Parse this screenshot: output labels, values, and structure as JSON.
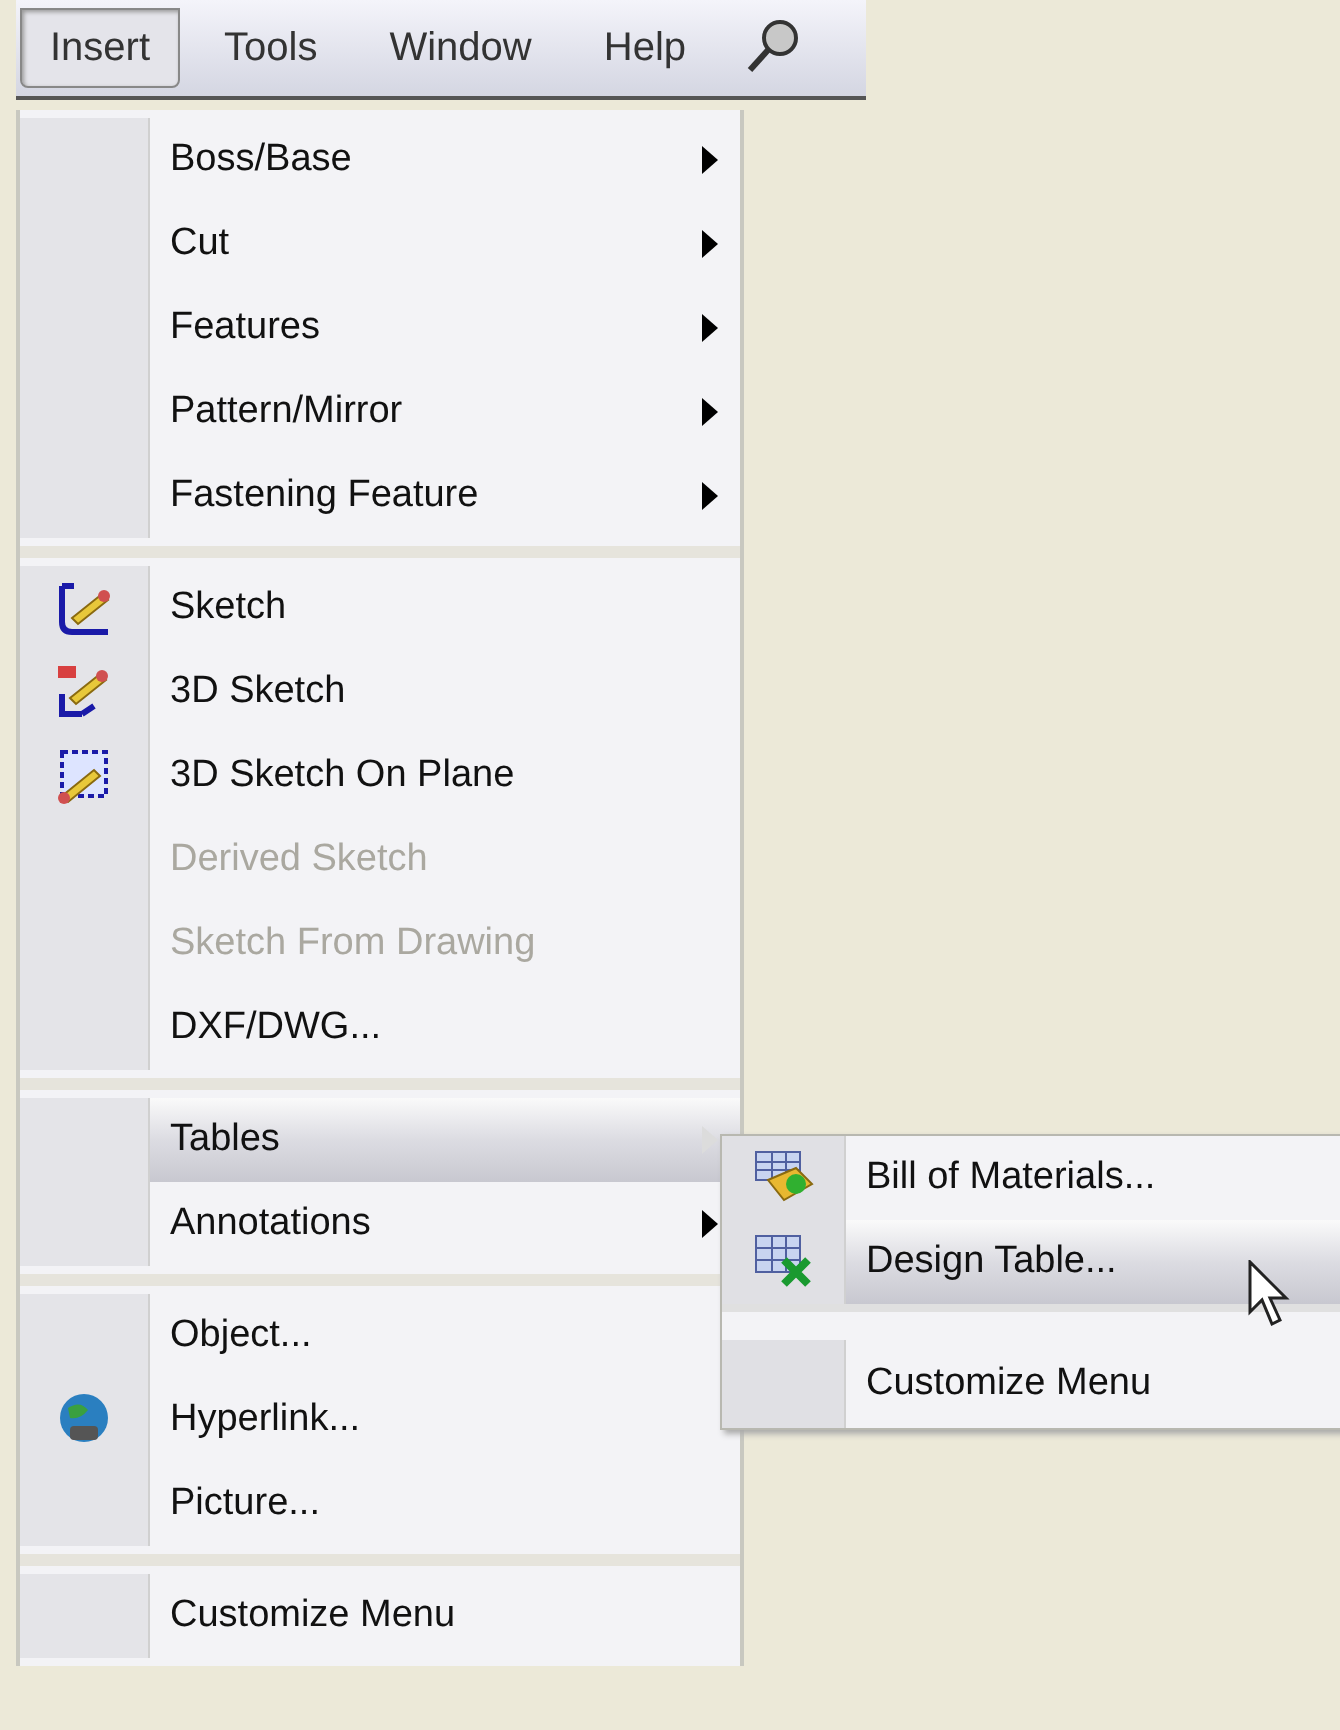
{
  "menubar": {
    "items": [
      {
        "label": "Insert",
        "selected": true
      },
      {
        "label": "Tools",
        "selected": false
      },
      {
        "label": "Window",
        "selected": false
      },
      {
        "label": "Help",
        "selected": false
      }
    ]
  },
  "menu": {
    "sections": [
      {
        "items": [
          {
            "label": "Boss/Base",
            "submenu": true,
            "disabled": false,
            "selected": false,
            "icon": false
          },
          {
            "label": "Cut",
            "submenu": true,
            "disabled": false,
            "selected": false,
            "icon": false
          },
          {
            "label": "Features",
            "submenu": true,
            "disabled": false,
            "selected": false,
            "icon": false
          },
          {
            "label": "Pattern/Mirror",
            "submenu": true,
            "disabled": false,
            "selected": false,
            "icon": false
          },
          {
            "label": "Fastening Feature",
            "submenu": true,
            "disabled": false,
            "selected": false,
            "icon": false
          }
        ]
      },
      {
        "items": [
          {
            "label": "Sketch",
            "submenu": false,
            "disabled": false,
            "selected": false,
            "icon": true
          },
          {
            "label": "3D Sketch",
            "submenu": false,
            "disabled": false,
            "selected": false,
            "icon": true
          },
          {
            "label": "3D Sketch On Plane",
            "submenu": false,
            "disabled": false,
            "selected": false,
            "icon": true
          },
          {
            "label": "Derived Sketch",
            "submenu": false,
            "disabled": true,
            "selected": false,
            "icon": false
          },
          {
            "label": "Sketch From Drawing",
            "submenu": false,
            "disabled": true,
            "selected": false,
            "icon": false
          },
          {
            "label": "DXF/DWG...",
            "submenu": false,
            "disabled": false,
            "selected": false,
            "icon": false
          }
        ]
      },
      {
        "items": [
          {
            "label": "Tables",
            "submenu": true,
            "disabled": false,
            "selected": true,
            "icon": false
          },
          {
            "label": "Annotations",
            "submenu": true,
            "disabled": false,
            "selected": false,
            "icon": false
          }
        ]
      },
      {
        "items": [
          {
            "label": "Object...",
            "submenu": false,
            "disabled": false,
            "selected": false,
            "icon": false
          },
          {
            "label": "Hyperlink...",
            "submenu": false,
            "disabled": false,
            "selected": false,
            "icon": true
          },
          {
            "label": "Picture...",
            "submenu": false,
            "disabled": false,
            "selected": false,
            "icon": false
          }
        ]
      },
      {
        "items": [
          {
            "label": "Customize Menu",
            "submenu": false,
            "disabled": false,
            "selected": false,
            "icon": false
          }
        ]
      }
    ]
  },
  "submenu": {
    "sections": [
      {
        "items": [
          {
            "label": "Bill of Materials...",
            "selected": false,
            "icon": true
          },
          {
            "label": "Design Table...",
            "selected": true,
            "icon": true
          }
        ]
      },
      {
        "items": [
          {
            "label": "Customize Menu",
            "selected": false,
            "icon": false
          }
        ]
      }
    ]
  }
}
